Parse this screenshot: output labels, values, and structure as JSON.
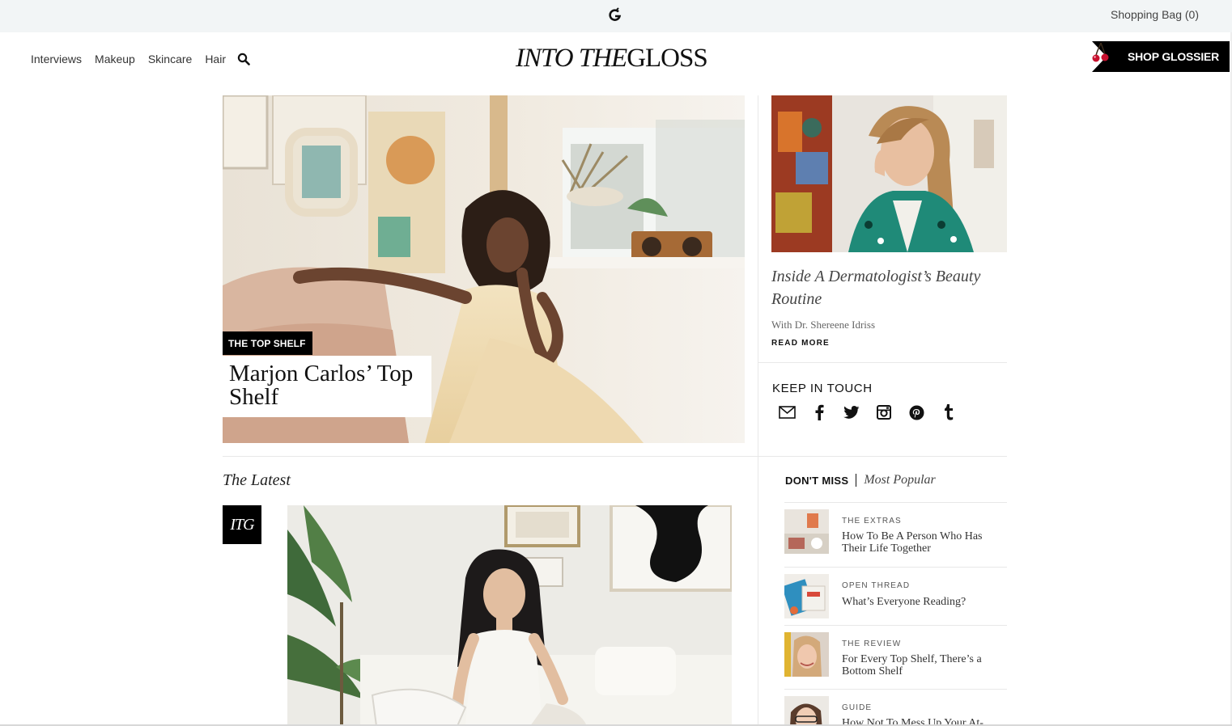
{
  "topbar": {
    "logo_icon": "glossier-g-icon",
    "shopping_bag": "Shopping Bag (0)"
  },
  "header": {
    "nav": [
      "Interviews",
      "Makeup",
      "Skincare",
      "Hair"
    ],
    "search_icon": "search-icon",
    "wordmark_italic": "INTO THE",
    "wordmark_regular": "GLOSS",
    "shop_button": "SHOP GLOSSIER"
  },
  "hero": {
    "kicker": "THE TOP SHELF",
    "title": "Marjon Carlos’ Top Shelf"
  },
  "feature": {
    "title": "Inside A Dermatologist’s Beauty Routine",
    "subtitle": "With Dr. Shereene Idriss",
    "read_more": "READ MORE"
  },
  "keep_in_touch": {
    "label": "KEEP IN TOUCH",
    "icons": [
      "mail-icon",
      "facebook-icon",
      "twitter-icon",
      "instagram-icon",
      "pinterest-icon",
      "tumblr-icon"
    ]
  },
  "latest": {
    "heading": "The Latest",
    "badge": "ITG"
  },
  "dont_miss": {
    "tab_active": "DON'T MISS",
    "tab_other": "Most Popular",
    "items": [
      {
        "category": "THE EXTRAS",
        "title": "How To Be A Person Who Has Their Life Together"
      },
      {
        "category": "OPEN THREAD",
        "title": "What’s Everyone Reading?"
      },
      {
        "category": "THE REVIEW",
        "title": "For Every Top Shelf, There’s a Bottom Shelf"
      },
      {
        "category": "GUIDE",
        "title": "How Not To Mess Up Your At-"
      }
    ]
  },
  "colors": {
    "topbar_bg": "#f2f5f6",
    "accent_black": "#000000",
    "cherry_red": "#c8102e"
  }
}
